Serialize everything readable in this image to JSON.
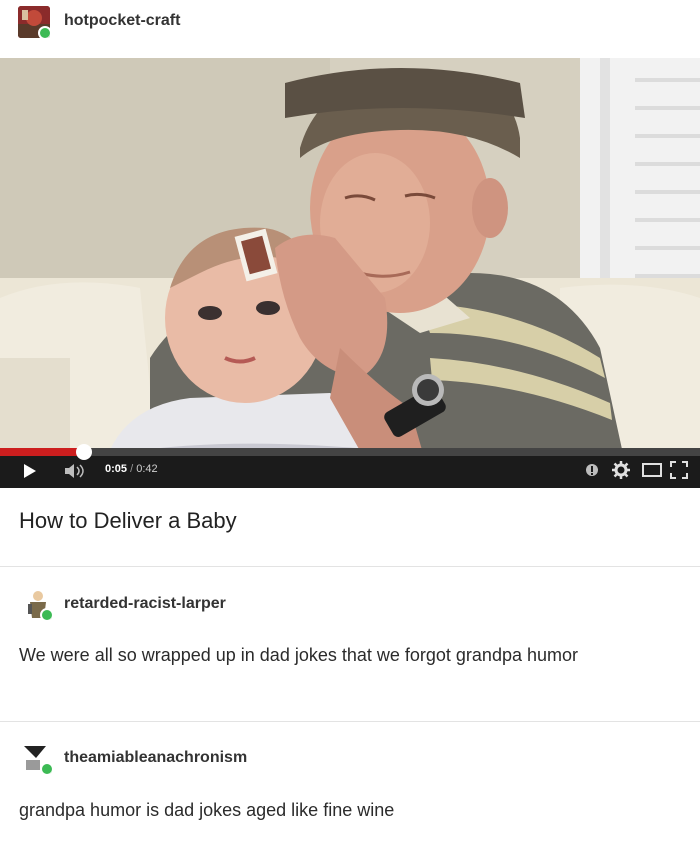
{
  "post": {
    "author": "hotpocket-craft",
    "video": {
      "title": "How to Deliver a Baby",
      "current_time": "0:05",
      "separator": "/",
      "duration": "0:42",
      "progress": 0.12
    }
  },
  "replies": [
    {
      "author": "retarded-racist-larper",
      "text": "We were all so wrapped up in dad jokes that we forgot grandpa humor"
    },
    {
      "author": "theamiableanachronism",
      "text": "grandpa humor is dad jokes aged like fine wine"
    }
  ],
  "colors": {
    "progress": "#cc1e1e",
    "badge": "#3cba54",
    "controls_bg": "#1b1b1b"
  },
  "icons": [
    "play-icon",
    "volume-icon",
    "annotations-icon",
    "settings-gear-icon",
    "theater-mode-icon",
    "fullscreen-icon"
  ]
}
